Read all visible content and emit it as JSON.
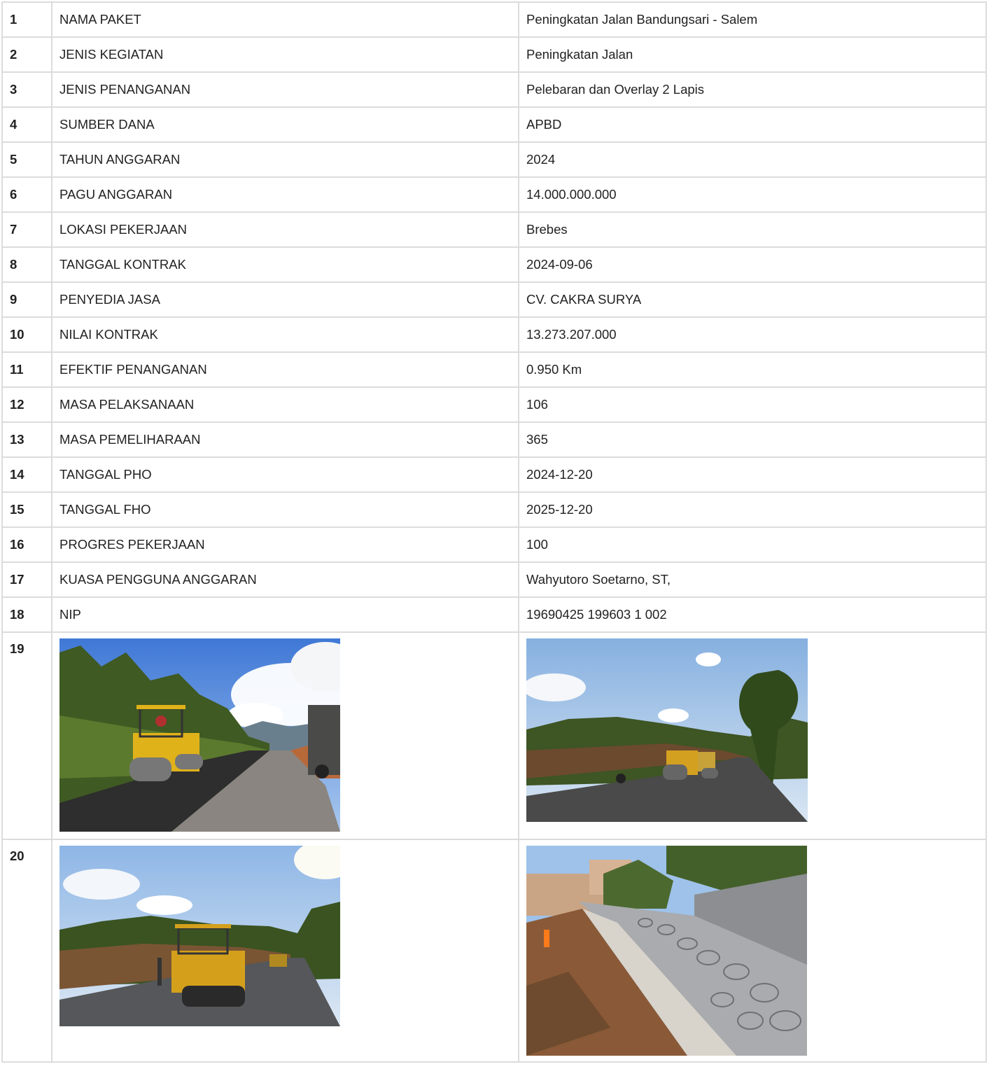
{
  "rows": [
    {
      "no": "1",
      "label": "NAMA PAKET",
      "value": "Peningkatan Jalan Bandungsari - Salem"
    },
    {
      "no": "2",
      "label": "JENIS KEGIATAN",
      "value": "Peningkatan Jalan"
    },
    {
      "no": "3",
      "label": "JENIS PENANGANAN",
      "value": "Pelebaran dan Overlay 2 Lapis"
    },
    {
      "no": "4",
      "label": "SUMBER DANA",
      "value": "APBD"
    },
    {
      "no": "5",
      "label": "TAHUN ANGGARAN",
      "value": "2024"
    },
    {
      "no": "6",
      "label": "PAGU ANGGARAN",
      "value": "14.000.000.000"
    },
    {
      "no": "7",
      "label": "LOKASI PEKERJAAN",
      "value": "Brebes"
    },
    {
      "no": "8",
      "label": "TANGGAL KONTRAK",
      "value": "2024-09-06"
    },
    {
      "no": "9",
      "label": "PENYEDIA JASA",
      "value": "CV. CAKRA SURYA"
    },
    {
      "no": "10",
      "label": "NILAI KONTRAK",
      "value": "13.273.207.000"
    },
    {
      "no": "11",
      "label": "EFEKTIF PENANGANAN",
      "value": "0.950 Km"
    },
    {
      "no": "12",
      "label": "MASA PELAKSANAAN",
      "value": "106"
    },
    {
      "no": "13",
      "label": "MASA PEMELIHARAAN",
      "value": "365"
    },
    {
      "no": "14",
      "label": "TANGGAL PHO",
      "value": "2024-12-20"
    },
    {
      "no": "15",
      "label": "TANGGAL FHO",
      "value": "2025-12-20"
    },
    {
      "no": "16",
      "label": "PROGRES PEKERJAAN",
      "value": "100"
    },
    {
      "no": "17",
      "label": "KUASA PENGGUNA ANGGARAN",
      "value": "Wahyutoro Soetarno, ST,"
    },
    {
      "no": "18",
      "label": "NIP",
      "value": "19690425 199603 1 002"
    }
  ],
  "photo_rows": [
    {
      "no": "19"
    },
    {
      "no": "20"
    }
  ],
  "colors": {
    "border": "#dcdcdc",
    "text": "#222222",
    "sky": "#8fb8e8",
    "asphalt": "#3a3a3a",
    "roller": "#e0b21a",
    "foliage": "#3f5a22"
  }
}
